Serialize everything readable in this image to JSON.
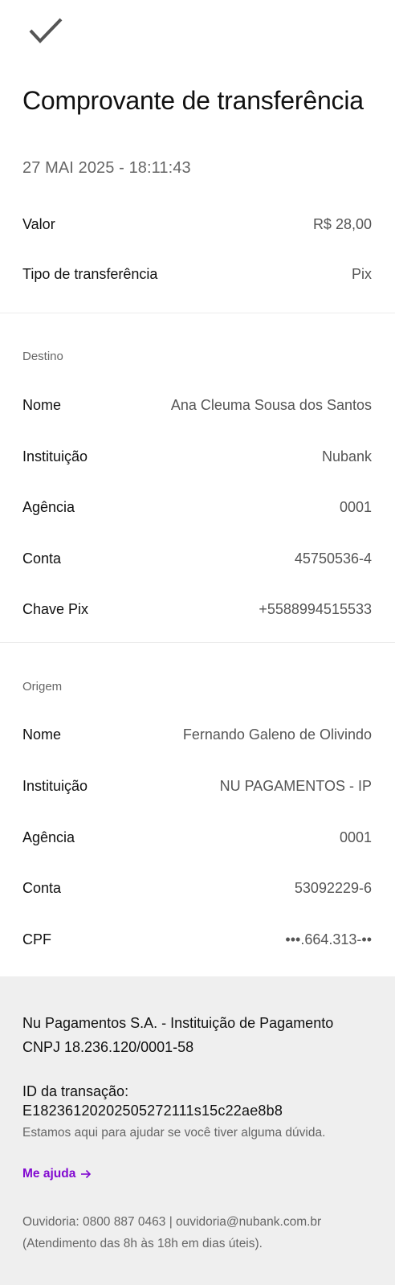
{
  "header": {
    "close_icon": "checkmark-icon",
    "title": "Comprovante de transferência",
    "date": "27 MAI 2025 - 18:11:43"
  },
  "summary": {
    "valor_label": "Valor",
    "valor_value": "R$ 28,00",
    "tipo_label": "Tipo de transferência",
    "tipo_value": "Pix"
  },
  "destino": {
    "heading": "Destino",
    "nome_label": "Nome",
    "nome_value": "Ana Cleuma Sousa dos Santos",
    "instituicao_label": "Instituição",
    "instituicao_value": "Nubank",
    "agencia_label": "Agência",
    "agencia_value": "0001",
    "conta_label": "Conta",
    "conta_value": "45750536-4",
    "chave_label": "Chave Pix",
    "chave_value": "+5588994515533"
  },
  "origem": {
    "heading": "Origem",
    "nome_label": "Nome",
    "nome_value": "Fernando Galeno de Olivindo",
    "instituicao_label": "Instituição",
    "instituicao_value": "NU PAGAMENTOS - IP",
    "agencia_label": "Agência",
    "agencia_value": "0001",
    "conta_label": "Conta",
    "conta_value": "53092229-6",
    "cpf_label": "CPF",
    "cpf_value": "•••.664.313-••"
  },
  "footer": {
    "company_line1": "Nu Pagamentos S.A. - Instituição de Pagamento",
    "company_line2": "CNPJ 18.236.120/0001-58",
    "txid_label": "ID da transação:",
    "txid_value": "E18236120202505272111s15c22ae8b8",
    "help_text": "Estamos aqui para ajudar se você tiver alguma dúvida.",
    "help_link": "Me ajuda",
    "help_link_icon": "arrow-right-icon",
    "ombudsman_line1": "Ouvidoria: 0800 887 0463 | ouvidoria@nubank.com.br",
    "ombudsman_line2": "(Atendimento das 8h às 18h em dias úteis).",
    "accent_color": "#820ad1",
    "background_color": "#efefef"
  }
}
